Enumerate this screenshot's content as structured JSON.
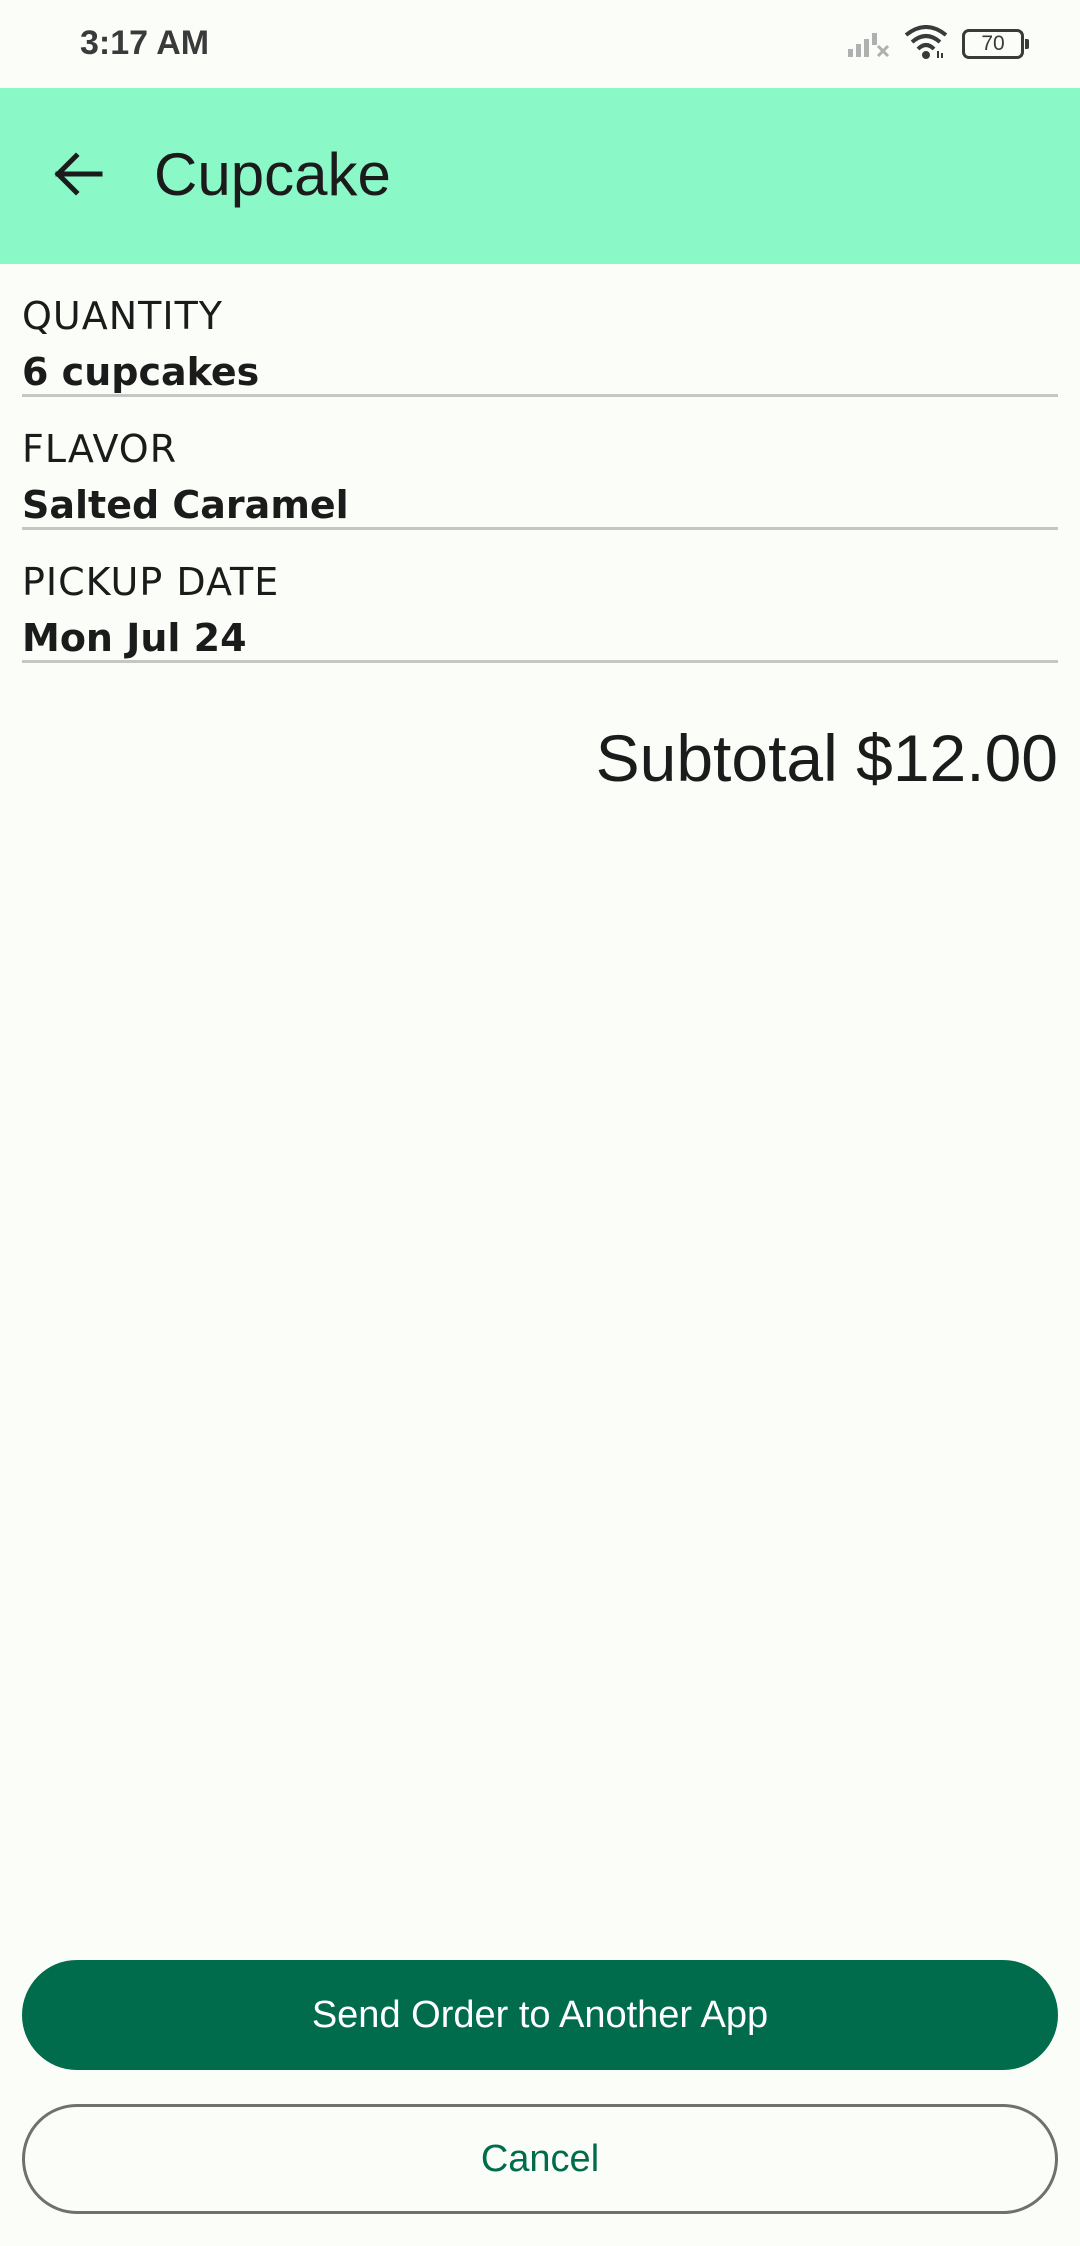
{
  "status_bar": {
    "time": "3:17 AM",
    "battery": "70",
    "icons": [
      "signal-off-icon",
      "wifi-icon",
      "battery-icon"
    ]
  },
  "app_bar": {
    "title": "Cupcake",
    "back_icon": "arrow-left-icon",
    "background": "#8bf8c8"
  },
  "summary": {
    "fields": [
      {
        "label": "QUANTITY",
        "value": "6 cupcakes"
      },
      {
        "label": "FLAVOR",
        "value": "Salted Caramel"
      },
      {
        "label": "PICKUP DATE",
        "value": "Mon Jul 24"
      }
    ],
    "subtotal": "Subtotal $12.00"
  },
  "actions": {
    "send_label": "Send Order to Another App",
    "cancel_label": "Cancel",
    "primary_color": "#006c4c"
  }
}
